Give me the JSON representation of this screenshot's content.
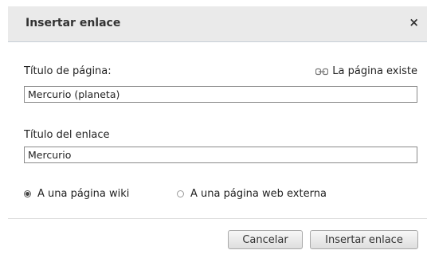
{
  "dialog": {
    "title": "Insertar enlace",
    "close_label": "×"
  },
  "page_title": {
    "label": "Título de página:",
    "status_text": "La página existe",
    "status_icon": "link-icon",
    "value": "Mercurio (planeta)"
  },
  "link_title": {
    "label": "Título del enlace",
    "value": "Mercurio"
  },
  "link_type": {
    "options": [
      {
        "label": "A una página wiki",
        "selected": true
      },
      {
        "label": "A una página web externa",
        "selected": false
      }
    ]
  },
  "buttons": {
    "cancel_label": "Cancelar",
    "insert_label": "Insertar enlace"
  }
}
